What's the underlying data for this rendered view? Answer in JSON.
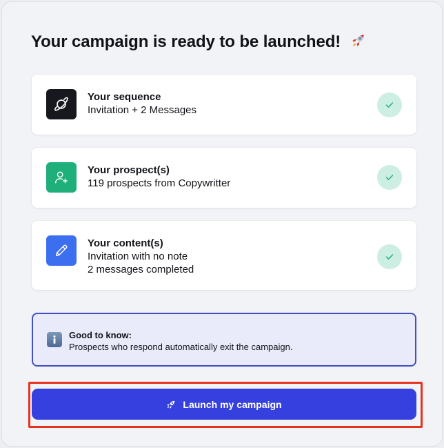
{
  "title": "Your campaign is ready to be launched!",
  "title_icon": "rocket-emoji",
  "cards": [
    {
      "icon": "planet-icon",
      "icon_bg": "#16181d",
      "heading": "Your sequence",
      "lines": [
        "Invitation + 2 Messages"
      ],
      "status": "check"
    },
    {
      "icon": "add-user-icon",
      "icon_bg": "#1eaf7a",
      "heading": "Your prospect(s)",
      "lines": [
        "119 prospects from Copywritter"
      ],
      "status": "check"
    },
    {
      "icon": "pencil-icon",
      "icon_bg": "#3c6ef0",
      "heading": "Your content(s)",
      "lines": [
        "Invitation with no note",
        "2 messages completed"
      ],
      "status": "check"
    }
  ],
  "note": {
    "icon": "info-icon",
    "heading": "Good to know:",
    "text": "Prospects who respond automatically exit the campaign."
  },
  "launch_button": {
    "icon": "rocket-icon",
    "label": "Launch my campaign"
  },
  "colors": {
    "accent": "#3640de",
    "check_bg": "#cdeee2",
    "check_stroke": "#2bb080",
    "highlight": "#e6331f"
  }
}
